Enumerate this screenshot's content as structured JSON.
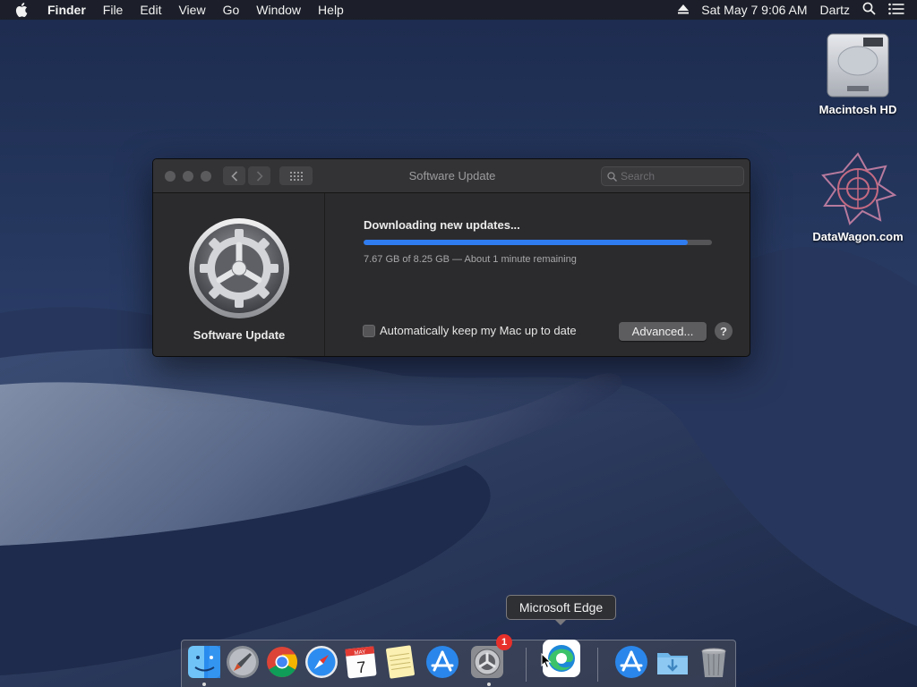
{
  "menubar": {
    "app_name": "Finder",
    "menus": [
      "File",
      "Edit",
      "View",
      "Go",
      "Window",
      "Help"
    ],
    "clock": "Sat May 7  9:06 AM",
    "user": "Dartz",
    "icons": [
      "apple-icon",
      "eject-icon",
      "spotlight-icon",
      "notification-center-icon"
    ]
  },
  "desktop": {
    "icons": [
      {
        "label": "Macintosh HD",
        "icon": "hard-drive-icon"
      },
      {
        "label": "DataWagon.com",
        "icon": "datawagon-logo-icon"
      }
    ]
  },
  "window": {
    "title": "Software Update",
    "search_placeholder": "Search",
    "pane_name": "Software Update",
    "status_title": "Downloading new updates...",
    "progress_fraction": 0.93,
    "progress_text": "7.67 GB of 8.25 GB — About 1 minute remaining",
    "auto_update_label": "Automatically keep my Mac up to date",
    "auto_update_checked": false,
    "advanced_label": "Advanced...",
    "help_label": "?"
  },
  "tooltip": {
    "text": "Microsoft Edge"
  },
  "dock": {
    "items": [
      {
        "name": "Finder",
        "icon": "finder-icon",
        "running": true
      },
      {
        "name": "Launchpad",
        "icon": "launchpad-icon",
        "running": false
      },
      {
        "name": "Google Chrome",
        "icon": "chrome-icon",
        "running": false
      },
      {
        "name": "Safari",
        "icon": "safari-icon",
        "running": false
      },
      {
        "name": "Calendar",
        "icon": "calendar-icon",
        "running": false,
        "month": "MAY",
        "day": "7"
      },
      {
        "name": "Notes",
        "icon": "notes-icon",
        "running": false
      },
      {
        "name": "App Store",
        "icon": "app-store-icon",
        "running": false
      },
      {
        "name": "System Preferences",
        "icon": "system-preferences-icon",
        "running": true,
        "badge": "1"
      },
      {
        "name": "Microsoft Edge",
        "icon": "edge-icon",
        "running": false
      },
      {
        "name": "App Store",
        "icon": "app-store-icon",
        "running": false
      },
      {
        "name": "Downloads",
        "icon": "downloads-folder-icon",
        "running": false
      },
      {
        "name": "Trash",
        "icon": "trash-icon",
        "running": false
      }
    ]
  },
  "colors": {
    "accent": "#2f7cf0",
    "badge": "#e8302a",
    "window_bg": "#2b2b2d"
  }
}
